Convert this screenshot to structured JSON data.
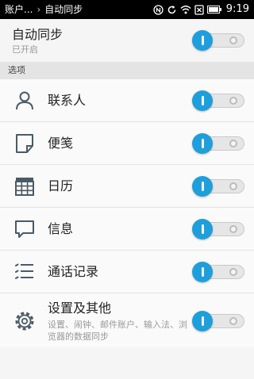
{
  "status_bar": {
    "breadcrumb_parent": "账户...",
    "breadcrumb_current": "自动同步",
    "time": "9:19",
    "icons": [
      "nfc-icon",
      "sync-icon",
      "wifi-icon",
      "no-sim-icon",
      "battery-icon"
    ]
  },
  "auto_sync": {
    "title": "自动同步",
    "status": "已开启",
    "enabled": true
  },
  "section": {
    "title": "选项"
  },
  "items": [
    {
      "label": "联系人",
      "icon": "contact-icon",
      "enabled": true
    },
    {
      "label": "便笺",
      "icon": "note-icon",
      "enabled": true
    },
    {
      "label": "日历",
      "icon": "calendar-icon",
      "enabled": true
    },
    {
      "label": "信息",
      "icon": "message-icon",
      "enabled": true
    },
    {
      "label": "通话记录",
      "icon": "call-log-icon",
      "enabled": true
    },
    {
      "label": "设置及其他",
      "sub": "设置、闹钟、邮件账户、输入法、浏览器的数据同步",
      "icon": "settings-icon",
      "enabled": true
    }
  ],
  "colors": {
    "accent": "#1e9fdb",
    "status_bar": "#000000",
    "section_header": "#e4e4e4"
  }
}
